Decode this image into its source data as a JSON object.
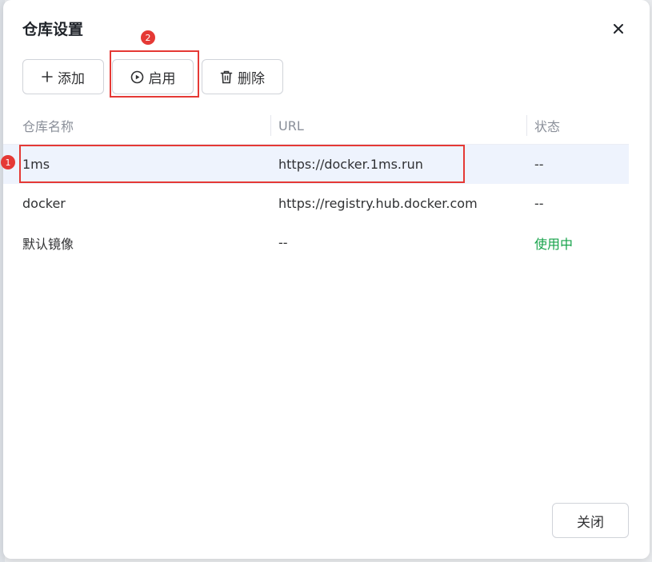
{
  "dialog": {
    "title": "仓库设置",
    "close_icon": "close-icon"
  },
  "toolbar": {
    "add_label": "添加",
    "add_icon": "plus-icon",
    "enable_label": "启用",
    "enable_icon": "play-circle-icon",
    "delete_label": "删除",
    "delete_icon": "trash-icon"
  },
  "table": {
    "columns": [
      "仓库名称",
      "URL",
      "状态"
    ],
    "rows": [
      {
        "name": "1ms",
        "url": "https://docker.1ms.run",
        "status": "--",
        "selected": true
      },
      {
        "name": "docker",
        "url": "https://registry.hub.docker.com",
        "status": "--",
        "selected": false
      },
      {
        "name": "默认镜像",
        "url": "--",
        "status": "使用中",
        "selected": false
      }
    ]
  },
  "annotations": {
    "marker_1": "1",
    "marker_2": "2",
    "color": "#e53935"
  },
  "footer": {
    "close_label": "关闭"
  },
  "colors": {
    "status_active": "#16a34a",
    "selected_row": "#eef3fd"
  }
}
